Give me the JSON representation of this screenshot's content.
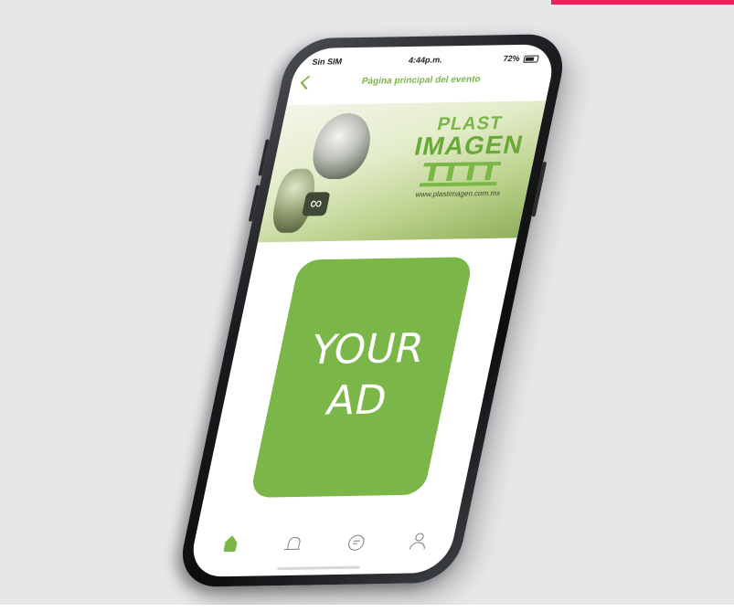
{
  "colors": {
    "accent": "#7ab648",
    "page_bg": "#e6e7e9",
    "top_accent": "#e0245e"
  },
  "status_bar": {
    "carrier": "Sin SIM",
    "time": "4:44p.m.",
    "battery": "72%"
  },
  "nav": {
    "title": "Página principal del evento",
    "back_icon": "chevron-left-icon"
  },
  "banner": {
    "logo_line1": "PLAST",
    "logo_line2": "IMAGEN",
    "url": "www.plastimagen.com.mx",
    "badge_glyph": "∞"
  },
  "ad": {
    "line1": "YOUR",
    "line2": "AD"
  },
  "tabbar": {
    "items": [
      {
        "icon": "home-icon",
        "active": true
      },
      {
        "icon": "bell-icon",
        "active": false
      },
      {
        "icon": "chat-icon",
        "active": false
      },
      {
        "icon": "user-icon",
        "active": false
      }
    ]
  }
}
